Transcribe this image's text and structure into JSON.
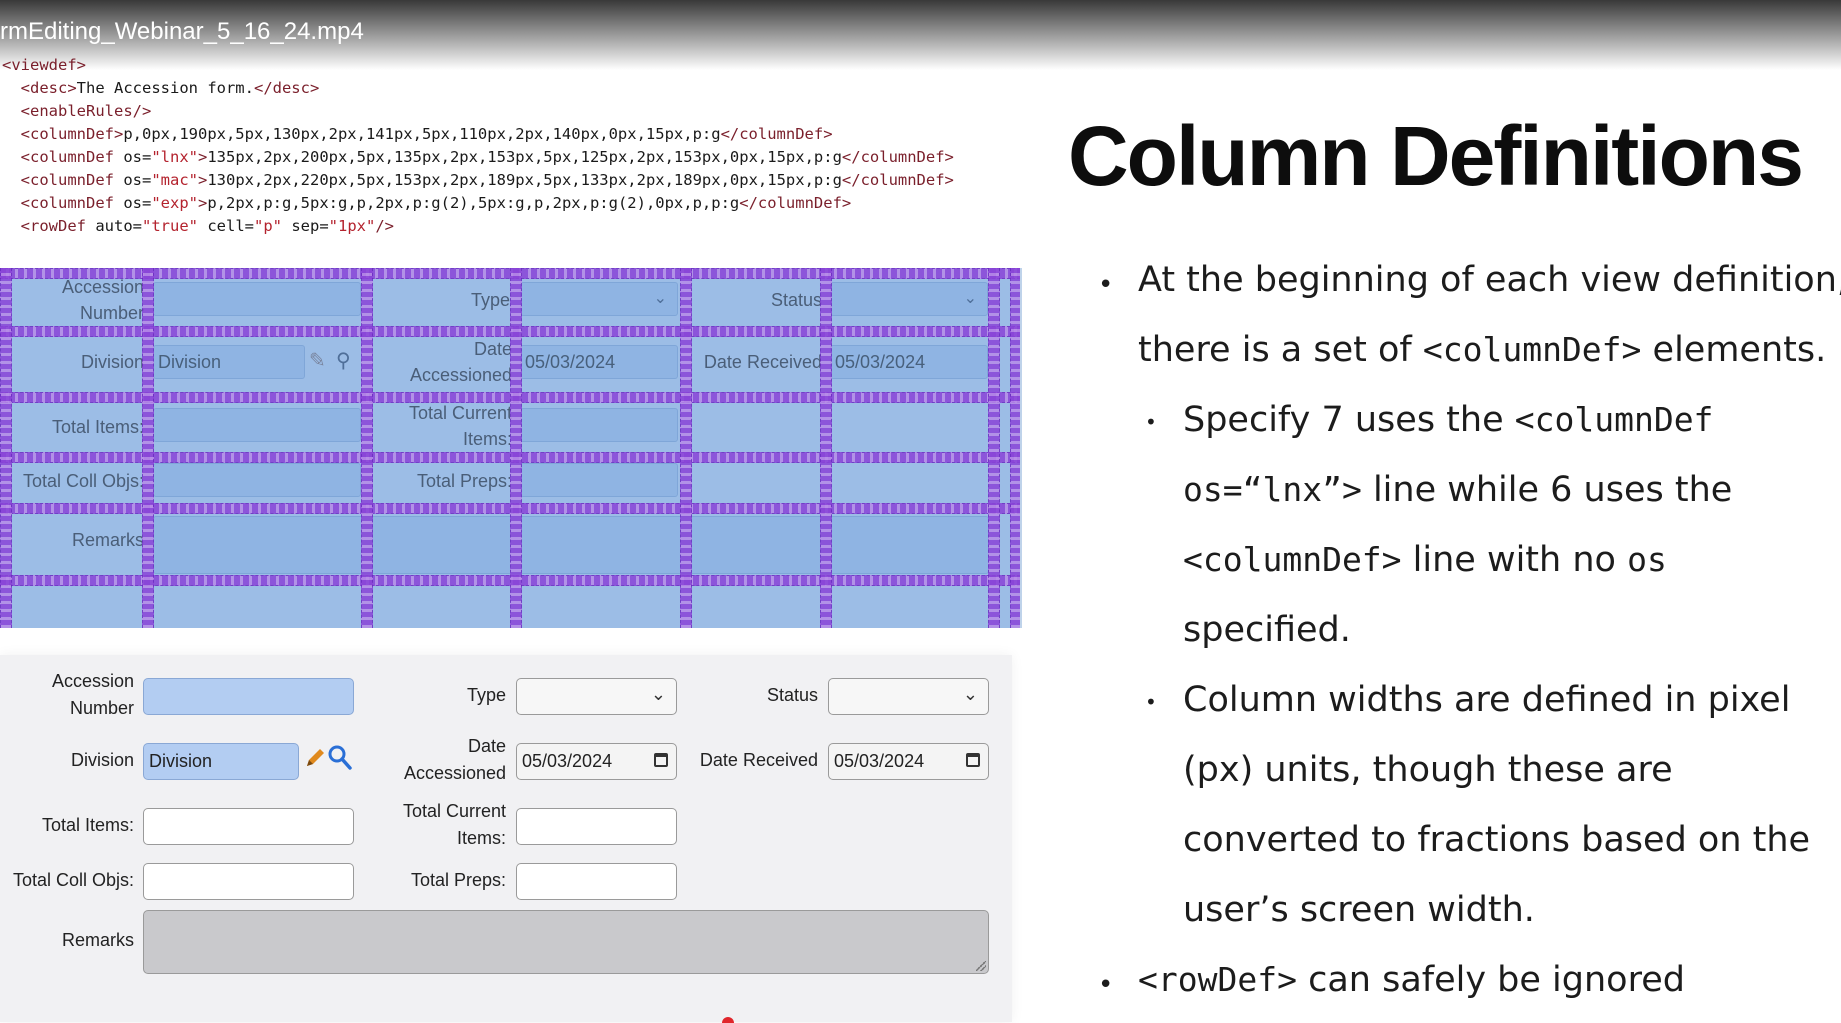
{
  "video": {
    "title": "rmEditing_Webinar_5_16_24.mp4"
  },
  "code": {
    "lines": [
      [
        [
          "tag",
          "<viewdef>"
        ]
      ],
      [
        [
          "txt",
          "  "
        ],
        [
          "tag",
          "<desc>"
        ],
        [
          "txt",
          "The Accession form."
        ],
        [
          "tag",
          "</desc>"
        ]
      ],
      [
        [
          "txt",
          "  "
        ],
        [
          "tag",
          "<enableRules/>"
        ]
      ],
      [
        [
          "txt",
          "  "
        ],
        [
          "tag",
          "<columnDef>"
        ],
        [
          "txt",
          "p,0px,190px,5px,130px,2px,141px,5px,110px,2px,140px,0px,15px,p:g"
        ],
        [
          "tag",
          "</columnDef>"
        ]
      ],
      [
        [
          "txt",
          "  "
        ],
        [
          "tag",
          "<columnDef "
        ],
        [
          "attr",
          "os="
        ],
        [
          "str",
          "\"lnx\""
        ],
        [
          "tag",
          ">"
        ],
        [
          "txt",
          "135px,2px,200px,5px,135px,2px,153px,5px,125px,2px,153px,0px,15px,p:g"
        ],
        [
          "tag",
          "</columnDef>"
        ]
      ],
      [
        [
          "txt",
          "  "
        ],
        [
          "tag",
          "<columnDef "
        ],
        [
          "attr",
          "os="
        ],
        [
          "str",
          "\"mac\""
        ],
        [
          "tag",
          ">"
        ],
        [
          "txt",
          "130px,2px,220px,5px,153px,2px,189px,5px,133px,2px,189px,0px,15px,p:g"
        ],
        [
          "tag",
          "</columnDef>"
        ]
      ],
      [
        [
          "txt",
          "  "
        ],
        [
          "tag",
          "<columnDef "
        ],
        [
          "attr",
          "os="
        ],
        [
          "str",
          "\"exp\""
        ],
        [
          "tag",
          ">"
        ],
        [
          "txt",
          "p,2px,p:g,5px:g,p,2px,p:g(2),5px:g,p,2px,p:g(2),0px,p,p:g"
        ],
        [
          "tag",
          "</columnDef>"
        ]
      ],
      [
        [
          "txt",
          "  "
        ],
        [
          "tag",
          "<rowDef "
        ],
        [
          "attr",
          "auto="
        ],
        [
          "str",
          "\"true\""
        ],
        [
          "attr",
          " cell="
        ],
        [
          "str",
          "\"p\""
        ],
        [
          "attr",
          " sep="
        ],
        [
          "str",
          "\"1px\""
        ],
        [
          "tag",
          "/>"
        ]
      ]
    ]
  },
  "slide": {
    "heading": "Column Definitions",
    "bullets": {
      "b1_line1": "At the beginning of each view definition,",
      "b1_line2_pre": "there is a set of ",
      "b1_line2_code": "<columnDef>",
      "b1_line2_post": " elements.",
      "s1_line1_pre": "Specify 7 uses the ",
      "s1_line1_code": "<columnDef",
      "s1_line2_code": "os=“lnx”>",
      "s1_line2_post": " line while 6 uses the",
      "s1_line3_code": "<columnDef>",
      "s1_line3_mid": " line with no ",
      "s1_line3_code2": "os",
      "s1_line4": "specified.",
      "s2_line1": "Column widths are defined in pixel",
      "s2_line2": "(px) units, though these are",
      "s2_line3": "converted to fractions based on the",
      "s2_line4": "user’s screen width.",
      "b2_code": "<rowDef>",
      "b2_post": " can safely be ignored"
    }
  },
  "grid_form": {
    "accession_label_1": "Accession",
    "accession_label_2": "Number",
    "type_label": "Type",
    "status_label": "Status",
    "division_label": "Division",
    "division_value": "Division",
    "date_label_1": "Date",
    "date_label_2": "Accessioned",
    "date_accessioned_value": "05/03/2024",
    "date_received_label": "Date Received",
    "date_received_value": "05/03/2024",
    "total_items_label": "Total Items:",
    "total_current_label_1": "Total Current",
    "total_current_label_2": "Items:",
    "total_coll_label": "Total Coll Objs:",
    "total_preps_label": "Total Preps:",
    "remarks_label": "Remarks"
  },
  "form": {
    "accession_label_1": "Accession",
    "accession_label_2": "Number",
    "type_label": "Type",
    "status_label": "Status",
    "division_label": "Division",
    "division_value": "Division",
    "date_label_1": "Date",
    "date_label_2": "Accessioned",
    "date_accessioned_value": "05/03/2024",
    "date_received_label": "Date Received",
    "date_received_value": "05/03/2024",
    "total_items_label": "Total Items:",
    "total_current_label_1": "Total Current",
    "total_current_label_2": "Items:",
    "total_coll_label": "Total Coll Objs:",
    "total_preps_label": "Total Preps:",
    "remarks_label": "Remarks"
  },
  "icons": {
    "edit": "pencil-icon",
    "search": "magnifier-icon",
    "dropdown": "chevron-down-icon",
    "calendar": "calendar-icon"
  },
  "colors": {
    "grid_fill": "#9cbde6",
    "grid_lines": "#8a44d8",
    "pencil": "#e08a1e",
    "search": "#2a6fd6",
    "highlight_input": "#b3cdf2"
  }
}
